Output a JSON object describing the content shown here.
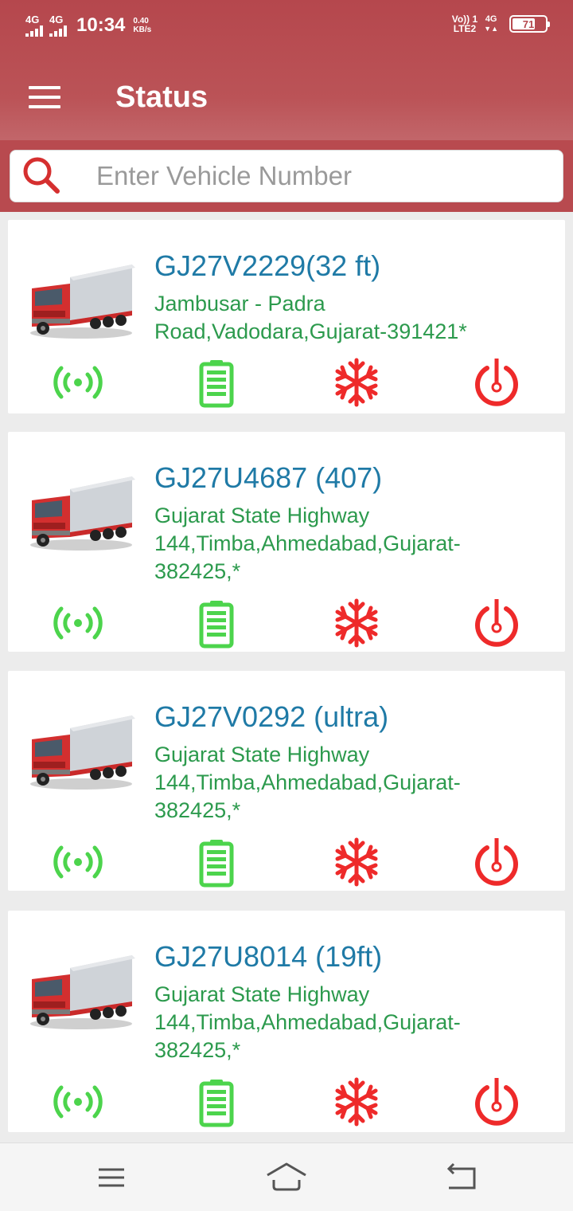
{
  "status_bar": {
    "signal1": "4G",
    "signal2": "4G",
    "time": "10:34",
    "speed_value": "0.40",
    "speed_unit": "KB/s",
    "volte_top": "Vo))",
    "volte_sim": "1",
    "volte_bottom": "LTE2",
    "net_type": "4G",
    "battery": "71",
    "battery_level": 71
  },
  "header": {
    "title": "Status"
  },
  "search": {
    "placeholder": "Enter Vehicle Number"
  },
  "colors": {
    "app_bar": "#b5474d",
    "vehicle_name": "#1f7aa6",
    "address": "#2c9a4d",
    "icon_green": "#4cd44c",
    "icon_red": "#ee2a2a"
  },
  "vehicles": [
    {
      "name": "GJ27V2229(32 ft)",
      "address_line1": "Jambusar - Padra",
      "address_line2": "Road,Vadodara,Gujarat-391421*",
      "address_line3": "",
      "icons": [
        "gps-signal-icon",
        "battery-icon",
        "snowflake-icon",
        "ignition-power-icon"
      ]
    },
    {
      "name": "GJ27U4687 (407)",
      "address_line1": "Gujarat State Highway",
      "address_line2": "144,Timba,Ahmedabad,Gujarat-",
      "address_line3": "382425,*",
      "icons": [
        "gps-signal-icon",
        "battery-icon",
        "snowflake-icon",
        "ignition-power-icon"
      ]
    },
    {
      "name": "GJ27V0292 (ultra)",
      "address_line1": "Gujarat State Highway",
      "address_line2": "144,Timba,Ahmedabad,Gujarat-",
      "address_line3": "382425,*",
      "icons": [
        "gps-signal-icon",
        "battery-icon",
        "snowflake-icon",
        "ignition-power-icon"
      ]
    },
    {
      "name": "GJ27U8014 (19ft)",
      "address_line1": "Gujarat State Highway",
      "address_line2": "144,Timba,Ahmedabad,Gujarat-",
      "address_line3": "382425,*",
      "icons": [
        "gps-signal-icon",
        "battery-icon",
        "snowflake-icon",
        "ignition-power-icon"
      ]
    }
  ],
  "nav": {
    "icons": [
      "recent-apps-icon",
      "home-icon",
      "back-icon"
    ]
  }
}
